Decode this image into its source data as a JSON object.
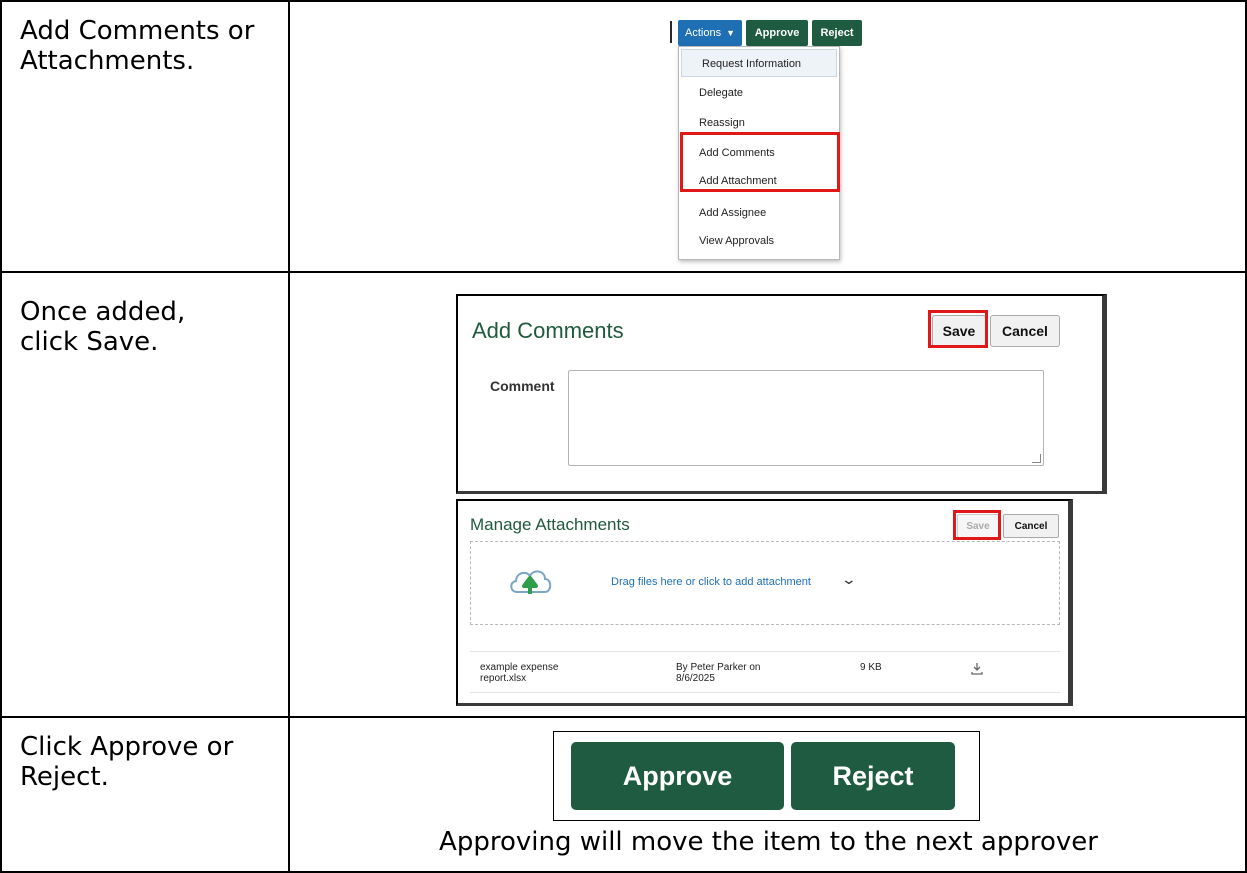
{
  "steps": [
    {
      "text": "Add Comments or Attachments."
    },
    {
      "text": "Once added, click Save."
    },
    {
      "text": "Click Approve or Reject."
    }
  ],
  "actions_menu": {
    "actions_label": "Actions",
    "approve_label": "Approve",
    "reject_label": "Reject",
    "items": [
      {
        "label": "Request Information"
      },
      {
        "label": "Delegate"
      },
      {
        "label": "Reassign"
      },
      {
        "label": "Add Comments"
      },
      {
        "label": "Add Attachment"
      },
      {
        "label": "Add Assignee"
      },
      {
        "label": "View Approvals"
      }
    ]
  },
  "add_comments": {
    "title": "Add Comments",
    "save_label": "Save",
    "cancel_label": "Cancel",
    "comment_label": "Comment",
    "comment_value": ""
  },
  "manage_attachments": {
    "title": "Manage Attachments",
    "save_label": "Save",
    "cancel_label": "Cancel",
    "drop_text": "Drag files here or click to add attachment",
    "files": [
      {
        "name": "example expense report.xlsx",
        "by": "By Peter Parker on 8/6/2025",
        "size": "9 KB"
      }
    ]
  },
  "final_buttons": {
    "approve_label": "Approve",
    "reject_label": "Reject",
    "caption": "Approving will move the item to the next approver"
  },
  "colors": {
    "brand_green": "#1e5b40",
    "actions_blue": "#1f6fb5",
    "highlight_red": "#e01818"
  }
}
